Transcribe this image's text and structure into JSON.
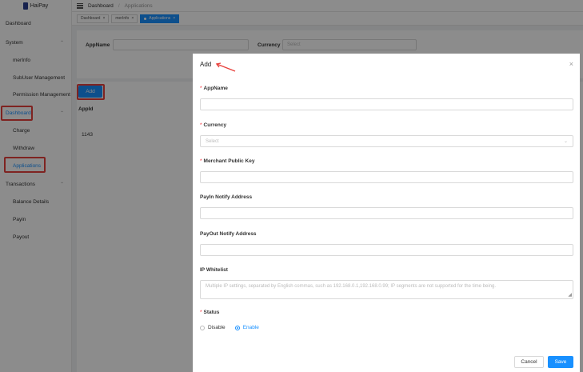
{
  "app": {
    "logo_text": "HaiPay"
  },
  "breadcrumb": {
    "root": "Dashboard",
    "separator": "/",
    "current": "Applications"
  },
  "tags": [
    {
      "label": "Dashboard"
    },
    {
      "label": "merInfo"
    },
    {
      "label": "Applications"
    }
  ],
  "sidebar": {
    "items": [
      {
        "label": "Dashboard"
      },
      {
        "label": "System"
      },
      {
        "label": "merInfo"
      },
      {
        "label": "SubUser Management"
      },
      {
        "label": "Permission Management"
      },
      {
        "label": "Dashboard"
      },
      {
        "label": "Charge"
      },
      {
        "label": "Withdraw"
      },
      {
        "label": "Applications"
      },
      {
        "label": "Transactions"
      },
      {
        "label": "Balance Details"
      },
      {
        "label": "Payin"
      },
      {
        "label": "Payout"
      }
    ]
  },
  "filters": {
    "appname_label": "AppName",
    "currency_label": "Currency",
    "currency_placeholder": "Select"
  },
  "main": {
    "add_label": "Add",
    "table_header": "AppId",
    "table_cell": "1143"
  },
  "drawer": {
    "title": "Add",
    "required_mark": "*",
    "appname_label": "AppName",
    "currency_label": "Currency",
    "currency_placeholder": "Select",
    "merchant_key_label": "Merchant Public Key",
    "payin_notify_label": "PayIn Notify Address",
    "payout_notify_label": "PayOut Notify Address",
    "ip_whitelist_label": "IP Whitelist",
    "ip_whitelist_placeholder": "Multiple IP settings, separated by English commas, such as 192.168.0.1,192.168.0.99; IP segments are not supported for the time being.",
    "status_label": "Status",
    "status_options": [
      {
        "label": "Disable"
      },
      {
        "label": "Enable"
      }
    ],
    "cancel_label": "Cancel",
    "save_label": "Save"
  },
  "colors": {
    "primary": "#1890ff",
    "highlight": "#e8413c"
  }
}
